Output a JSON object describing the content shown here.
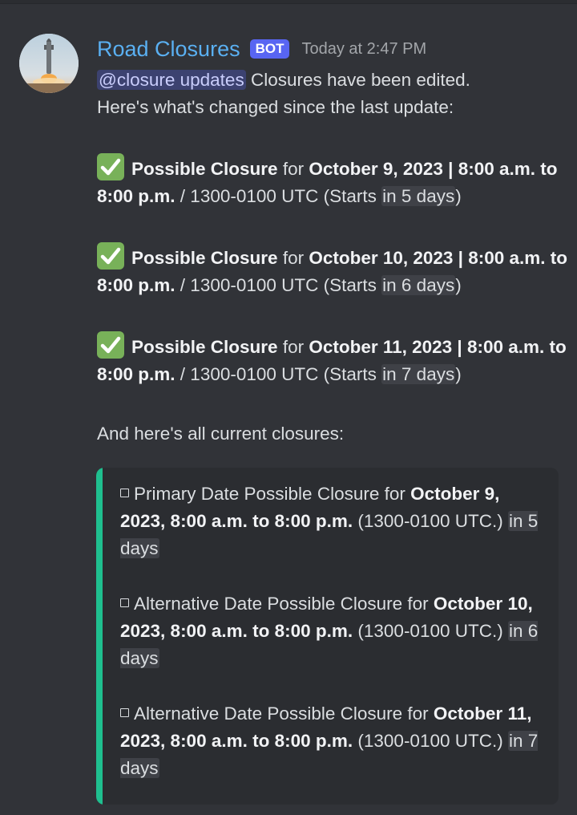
{
  "message": {
    "author": "Road Closures",
    "bot_tag": "BOT",
    "timestamp": "Today at 2:47 PM",
    "mention": "@closure updates",
    "intro_line1": " Closures have been edited.",
    "intro_line2": "Here's what's changed since the last update:",
    "closures": [
      {
        "label": "Possible Closure",
        "for": " for ",
        "date": "October 9, 2023 | 8:00 a.m. to 8:00 p.m.",
        "rest": " / 1300-0100 UTC (Starts ",
        "relative": "in 5 days",
        "end": ")"
      },
      {
        "label": "Possible Closure",
        "for": " for ",
        "date": "October 10, 2023 | 8:00 a.m. to 8:00 p.m.",
        "rest": " / 1300-0100 UTC (Starts ",
        "relative": "in 6 days",
        "end": ")"
      },
      {
        "label": "Possible Closure",
        "for": " for ",
        "date": "October 11, 2023 | 8:00 a.m. to 8:00 p.m.",
        "rest": " / 1300-0100 UTC (Starts ",
        "relative": "in 7 days",
        "end": ")"
      }
    ],
    "all_current": "And here's all current closures:"
  },
  "embed": {
    "accent_color": "#1fbf8f",
    "items": [
      {
        "prefix": "Primary Date Possible Closure for ",
        "date": "October 9, 2023, 8:00 a.m. to 8:00 p.m.",
        "utc": " (1300-0100 UTC.) ",
        "relative": "in 5 days"
      },
      {
        "prefix": "Alternative Date Possible Closure for ",
        "date": "October 10, 2023, 8:00 a.m. to 8:00 p.m.",
        "utc": " (1300-0100 UTC.) ",
        "relative": "in 6 days"
      },
      {
        "prefix": "Alternative Date Possible Closure for ",
        "date": "October 11, 2023, 8:00 a.m. to 8:00 p.m.",
        "utc": " (1300-0100 UTC.) ",
        "relative": "in 7 days"
      }
    ]
  },
  "icons": {
    "avatar": "rocket-launch-avatar",
    "check": "white-check-mark-icon",
    "bullet": "white-square-bullet-icon"
  }
}
